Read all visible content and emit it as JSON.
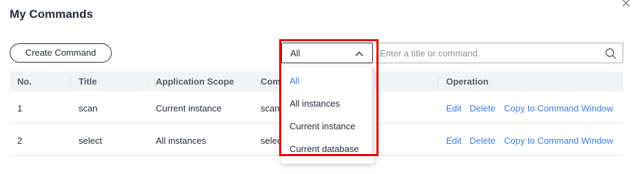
{
  "dialog": {
    "title": "My Commands",
    "close_icon": "close-icon"
  },
  "toolbar": {
    "create_label": "Create Command",
    "filter_value": "All",
    "search_placeholder": "Enter a title or command."
  },
  "table": {
    "headers": {
      "no": "No.",
      "title": "Title",
      "scope": "Application Scope",
      "command": "Com",
      "operation": "Operation"
    },
    "rows": [
      {
        "no": "1",
        "title": "scan",
        "scope": "Current instance",
        "command": "scan",
        "edit": "Edit",
        "delete": "Delete",
        "copy": "Copy to Command Window"
      },
      {
        "no": "2",
        "title": "select",
        "scope": "All instances",
        "command": "selec",
        "edit": "Edit",
        "delete": "Delete",
        "copy": "Copy to Command Window"
      }
    ]
  },
  "dropdown": {
    "options": [
      "All",
      "All instances",
      "Current instance",
      "Current database"
    ],
    "selected": "All"
  },
  "colors": {
    "link": "#3a7ee0",
    "highlight": "#e00000"
  }
}
